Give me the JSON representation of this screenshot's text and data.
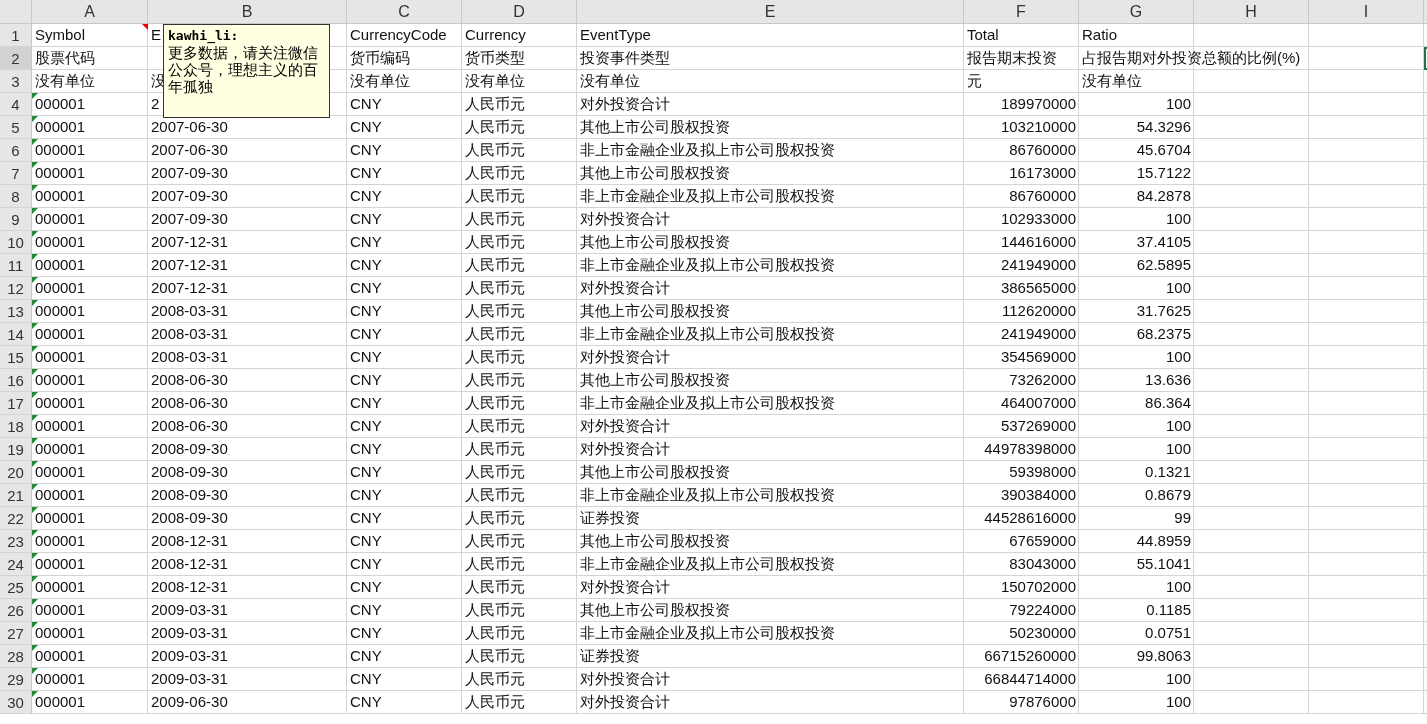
{
  "columns": [
    "A",
    "B",
    "C",
    "D",
    "E",
    "F",
    "G",
    "H",
    "I"
  ],
  "rows": [
    {
      "number": "1",
      "kind": "header",
      "selected": false,
      "cells": [
        "Symbol",
        "E",
        "CurrencyCode",
        "Currency",
        "EventType",
        "Total",
        "Ratio"
      ]
    },
    {
      "number": "2",
      "kind": "header",
      "selected": true,
      "cells": [
        "股票代码",
        "",
        "货币编码",
        "货币类型",
        "投资事件类型",
        "报告期末投资",
        "占报告期对外投资总额的比例(%)"
      ]
    },
    {
      "number": "3",
      "kind": "header",
      "selected": false,
      "cells": [
        "没有单位",
        "没",
        "没有单位",
        "没有单位",
        "没有单位",
        "元",
        "没有单位"
      ]
    },
    {
      "number": "4",
      "kind": "data",
      "flag": true,
      "selected": false,
      "cells": [
        "000001",
        "2",
        "CNY",
        "人民币元",
        "对外投资合计",
        "189970000",
        "100"
      ]
    },
    {
      "number": "5",
      "kind": "data",
      "flag": true,
      "selected": false,
      "cells": [
        "000001",
        "2007-06-30",
        "CNY",
        "人民币元",
        "其他上市公司股权投资",
        "103210000",
        "54.3296"
      ]
    },
    {
      "number": "6",
      "kind": "data",
      "flag": true,
      "selected": false,
      "cells": [
        "000001",
        "2007-06-30",
        "CNY",
        "人民币元",
        "非上市金融企业及拟上市公司股权投资",
        "86760000",
        "45.6704"
      ]
    },
    {
      "number": "7",
      "kind": "data",
      "flag": true,
      "selected": false,
      "cells": [
        "000001",
        "2007-09-30",
        "CNY",
        "人民币元",
        "其他上市公司股权投资",
        "16173000",
        "15.7122"
      ]
    },
    {
      "number": "8",
      "kind": "data",
      "flag": true,
      "selected": false,
      "cells": [
        "000001",
        "2007-09-30",
        "CNY",
        "人民币元",
        "非上市金融企业及拟上市公司股权投资",
        "86760000",
        "84.2878"
      ]
    },
    {
      "number": "9",
      "kind": "data",
      "flag": true,
      "selected": false,
      "cells": [
        "000001",
        "2007-09-30",
        "CNY",
        "人民币元",
        "对外投资合计",
        "102933000",
        "100"
      ]
    },
    {
      "number": "10",
      "kind": "data",
      "flag": true,
      "selected": false,
      "cells": [
        "000001",
        "2007-12-31",
        "CNY",
        "人民币元",
        "其他上市公司股权投资",
        "144616000",
        "37.4105"
      ]
    },
    {
      "number": "11",
      "kind": "data",
      "flag": true,
      "selected": false,
      "cells": [
        "000001",
        "2007-12-31",
        "CNY",
        "人民币元",
        "非上市金融企业及拟上市公司股权投资",
        "241949000",
        "62.5895"
      ]
    },
    {
      "number": "12",
      "kind": "data",
      "flag": true,
      "selected": false,
      "cells": [
        "000001",
        "2007-12-31",
        "CNY",
        "人民币元",
        "对外投资合计",
        "386565000",
        "100"
      ]
    },
    {
      "number": "13",
      "kind": "data",
      "flag": true,
      "selected": false,
      "cells": [
        "000001",
        "2008-03-31",
        "CNY",
        "人民币元",
        "其他上市公司股权投资",
        "112620000",
        "31.7625"
      ]
    },
    {
      "number": "14",
      "kind": "data",
      "flag": true,
      "selected": false,
      "cells": [
        "000001",
        "2008-03-31",
        "CNY",
        "人民币元",
        "非上市金融企业及拟上市公司股权投资",
        "241949000",
        "68.2375"
      ]
    },
    {
      "number": "15",
      "kind": "data",
      "flag": true,
      "selected": false,
      "cells": [
        "000001",
        "2008-03-31",
        "CNY",
        "人民币元",
        "对外投资合计",
        "354569000",
        "100"
      ]
    },
    {
      "number": "16",
      "kind": "data",
      "flag": true,
      "selected": false,
      "cells": [
        "000001",
        "2008-06-30",
        "CNY",
        "人民币元",
        "其他上市公司股权投资",
        "73262000",
        "13.636"
      ]
    },
    {
      "number": "17",
      "kind": "data",
      "flag": true,
      "selected": false,
      "cells": [
        "000001",
        "2008-06-30",
        "CNY",
        "人民币元",
        "非上市金融企业及拟上市公司股权投资",
        "464007000",
        "86.364"
      ]
    },
    {
      "number": "18",
      "kind": "data",
      "flag": true,
      "selected": false,
      "cells": [
        "000001",
        "2008-06-30",
        "CNY",
        "人民币元",
        "对外投资合计",
        "537269000",
        "100"
      ]
    },
    {
      "number": "19",
      "kind": "data",
      "flag": true,
      "selected": false,
      "cells": [
        "000001",
        "2008-09-30",
        "CNY",
        "人民币元",
        "对外投资合计",
        "44978398000",
        "100"
      ]
    },
    {
      "number": "20",
      "kind": "data",
      "flag": true,
      "selected": false,
      "cells": [
        "000001",
        "2008-09-30",
        "CNY",
        "人民币元",
        "其他上市公司股权投资",
        "59398000",
        "0.1321"
      ]
    },
    {
      "number": "21",
      "kind": "data",
      "flag": true,
      "selected": false,
      "cells": [
        "000001",
        "2008-09-30",
        "CNY",
        "人民币元",
        "非上市金融企业及拟上市公司股权投资",
        "390384000",
        "0.8679"
      ]
    },
    {
      "number": "22",
      "kind": "data",
      "flag": true,
      "selected": false,
      "cells": [
        "000001",
        "2008-09-30",
        "CNY",
        "人民币元",
        "证券投资",
        "44528616000",
        "99"
      ]
    },
    {
      "number": "23",
      "kind": "data",
      "flag": true,
      "selected": false,
      "cells": [
        "000001",
        "2008-12-31",
        "CNY",
        "人民币元",
        "其他上市公司股权投资",
        "67659000",
        "44.8959"
      ]
    },
    {
      "number": "24",
      "kind": "data",
      "flag": true,
      "selected": false,
      "cells": [
        "000001",
        "2008-12-31",
        "CNY",
        "人民币元",
        "非上市金融企业及拟上市公司股权投资",
        "83043000",
        "55.1041"
      ]
    },
    {
      "number": "25",
      "kind": "data",
      "flag": true,
      "selected": false,
      "cells": [
        "000001",
        "2008-12-31",
        "CNY",
        "人民币元",
        "对外投资合计",
        "150702000",
        "100"
      ]
    },
    {
      "number": "26",
      "kind": "data",
      "flag": true,
      "selected": false,
      "cells": [
        "000001",
        "2009-03-31",
        "CNY",
        "人民币元",
        "其他上市公司股权投资",
        "79224000",
        "0.1185"
      ]
    },
    {
      "number": "27",
      "kind": "data",
      "flag": true,
      "selected": false,
      "cells": [
        "000001",
        "2009-03-31",
        "CNY",
        "人民币元",
        "非上市金融企业及拟上市公司股权投资",
        "50230000",
        "0.0751"
      ]
    },
    {
      "number": "28",
      "kind": "data",
      "flag": true,
      "selected": false,
      "cells": [
        "000001",
        "2009-03-31",
        "CNY",
        "人民币元",
        "证券投资",
        "66715260000",
        "99.8063"
      ]
    },
    {
      "number": "29",
      "kind": "data",
      "flag": true,
      "selected": false,
      "cells": [
        "000001",
        "2009-03-31",
        "CNY",
        "人民币元",
        "对外投资合计",
        "66844714000",
        "100"
      ]
    },
    {
      "number": "30",
      "kind": "data",
      "flag": true,
      "selected": false,
      "cells": [
        "000001",
        "2009-06-30",
        "CNY",
        "人民币元",
        "对外投资合计",
        "97876000",
        "100"
      ]
    }
  ],
  "comment": {
    "author": "kawhi_li:",
    "text": "更多数据，请关注微信公众号，理想主义的百年孤独"
  }
}
